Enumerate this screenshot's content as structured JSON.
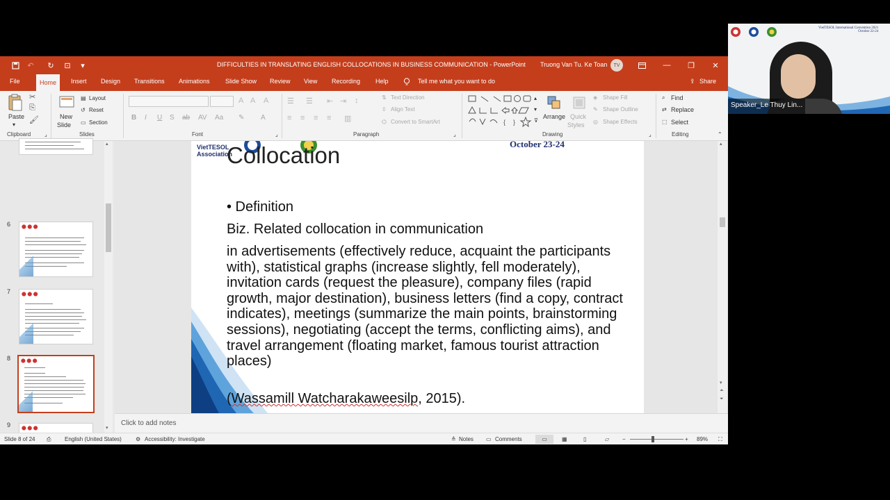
{
  "window": {
    "title": "DIFFICULTIES IN TRANSLATING ENGLISH COLLOCATIONS IN BUSINESS COMMUNICATION  -  PowerPoint",
    "user_name": "Truong Van Tu. Ke Toan",
    "user_initials": "TV"
  },
  "menu": {
    "tabs": [
      "File",
      "Home",
      "Insert",
      "Design",
      "Transitions",
      "Animations",
      "Slide Show",
      "Review",
      "View",
      "Recording",
      "Help"
    ],
    "tell_me": "Tell me what you want to do",
    "share": "Share"
  },
  "ribbon": {
    "clipboard": {
      "paste": "Paste",
      "label": "Clipboard"
    },
    "slides": {
      "new_slide": "New",
      "new_slide_2": "Slide",
      "layout": "Layout",
      "reset": "Reset",
      "section": "Section",
      "label": "Slides"
    },
    "font": {
      "label": "Font",
      "buttons": [
        "B",
        "I",
        "U",
        "S",
        "ab",
        "AV",
        "Aa",
        "A"
      ]
    },
    "paragraph": {
      "label": "Paragraph",
      "text_direction": "Text Direction",
      "align_text": "Align Text",
      "smartart": "Convert to SmartArt"
    },
    "drawing": {
      "label": "Drawing",
      "arrange": "Arrange",
      "quick_styles": "Quick",
      "quick_styles_2": "Styles",
      "shape_fill": "Shape Fill",
      "shape_outline": "Shape Outline",
      "shape_effects": "Shape Effects"
    },
    "editing": {
      "label": "Editing",
      "find": "Find",
      "replace": "Replace",
      "select": "Select"
    }
  },
  "thumbnails": [
    {
      "number": "6",
      "selected": false
    },
    {
      "number": "7",
      "selected": false
    },
    {
      "number": "8",
      "selected": true
    },
    {
      "number": "9",
      "selected": false
    }
  ],
  "slide": {
    "title": "Collocation",
    "date_banner": "October 23-24",
    "logo_text": "VietTESOL Association",
    "bullet": "• Definition",
    "subheading": "Biz. Related collocation in communication",
    "body": "in advertisements (effectively reduce, acquaint the participants with), statistical graphs (increase slightly, fell moderately), invitation cards (request the pleasure), company files (rapid growth, major destination), business letters (find a copy, contract indicates), meetings (summarize the main points, brainstorming sessions), negotiating (accept the terms, conflicting aims), and travel arrangement (floating market, famous tourist attraction places)",
    "citation_open": "(",
    "citation_author": "Wassamill Watcharakaweesilp",
    "citation_close": ", 2015)."
  },
  "notes": {
    "placeholder": "Click to add notes"
  },
  "status": {
    "slide_counter": "Slide 8 of 24",
    "language": "English (United States)",
    "accessibility": "Accessibility: Investigate",
    "notes": "Notes",
    "comments": "Comments",
    "zoom": "89%"
  },
  "video": {
    "banner_line1": "VietTESOL International Convention 2021",
    "banner_line2": "October 22-24",
    "speaker_label": "Speaker_Le Thuy Lin..."
  },
  "colors": {
    "accent": "#c43e1c",
    "slide_date": "#1f2f6d"
  }
}
